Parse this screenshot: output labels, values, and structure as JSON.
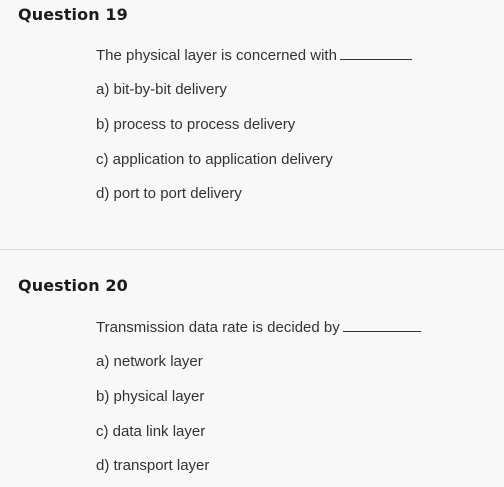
{
  "questions": [
    {
      "title": "Question 19",
      "prompt": "The physical layer is concerned with",
      "options": [
        "a) bit-by-bit delivery",
        "b) process to process delivery",
        "c) application to application delivery",
        "d) port to port delivery"
      ]
    },
    {
      "title": "Question 20",
      "prompt": "Transmission data rate is decided by",
      "options": [
        "a) network layer",
        "b) physical layer",
        "c) data link layer",
        "d) transport layer"
      ]
    }
  ],
  "colors": {
    "background": "#f8f8f8",
    "divider": "#d9d9d9",
    "title_text": "#1b1b1b",
    "body_text": "#333333"
  }
}
